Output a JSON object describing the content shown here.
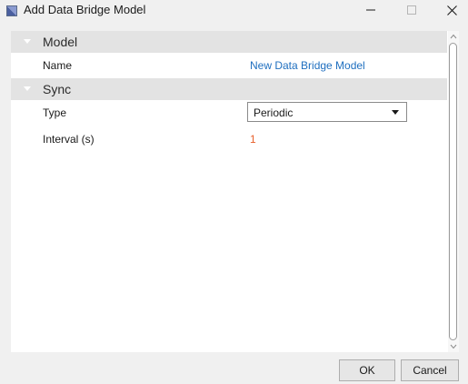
{
  "window": {
    "title": "Add Data Bridge Model"
  },
  "groups": [
    {
      "title": "Model",
      "rows": [
        {
          "label": "Name",
          "value": "New Data Bridge Model"
        }
      ]
    },
    {
      "title": "Sync",
      "rows": [
        {
          "label": "Type",
          "value": "Periodic"
        },
        {
          "label": "Interval (s)",
          "value": "1"
        }
      ]
    }
  ],
  "buttons": {
    "ok": "OK",
    "cancel": "Cancel"
  },
  "colors": {
    "link": "#1f6fbf",
    "number": "#e8602c",
    "group_header": "#e3e3e3"
  },
  "icons": {
    "app": "data-bridge-app-icon",
    "minimize": "minimize-icon",
    "maximize": "maximize-icon",
    "close": "close-icon"
  }
}
